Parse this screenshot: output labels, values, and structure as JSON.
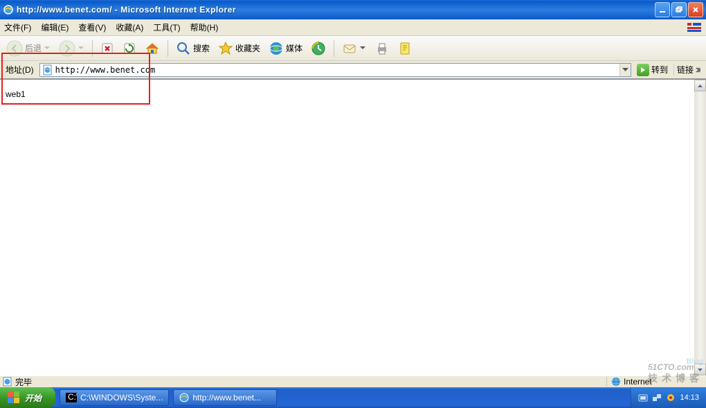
{
  "window": {
    "title": "http://www.benet.com/ - Microsoft Internet Explorer"
  },
  "menus": {
    "file": "文件(F)",
    "edit": "编辑(E)",
    "view": "查看(V)",
    "favorites": "收藏(A)",
    "tools": "工具(T)",
    "help": "帮助(H)"
  },
  "toolbar": {
    "back": "后退",
    "search": "搜索",
    "favorites": "收藏夹",
    "media": "媒体"
  },
  "address": {
    "label": "地址(D)",
    "url": "http://www.benet.com",
    "go": "转到",
    "links": "链接"
  },
  "page": {
    "body": "web1"
  },
  "status": {
    "text": "完毕",
    "zone": "Internet"
  },
  "taskbar": {
    "start": "开始",
    "task1": "C:\\WINDOWS\\Syste...",
    "task2": "http://www.benet...",
    "clock": "14:13"
  },
  "watermark": {
    "main": "51CTO.com",
    "sub": "技术博客",
    "blog": "Blog"
  }
}
